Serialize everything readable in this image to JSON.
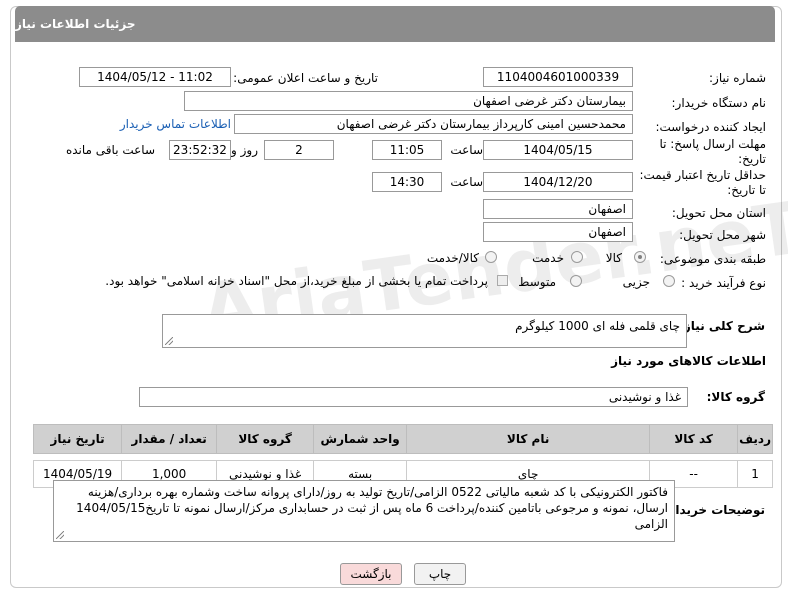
{
  "header": {
    "title": "جزئیات اطلاعات نیاز"
  },
  "watermark": "AriaTender.neT",
  "fields": {
    "need_number_label": "شماره نیاز:",
    "need_number": "1104004601000339",
    "announce_label": "تاریخ و ساعت اعلان عمومی:",
    "announce_value": "1404/05/12 - 11:02",
    "buyer_org_label": "نام دستگاه خریدار:",
    "buyer_org": "بیمارستان دکتر غرضی اصفهان",
    "creator_label": "ایجاد کننده درخواست:",
    "creator": "محمدحسین امینی کارپرداز بیمارستان دکتر غرضی اصفهان",
    "contact_link": "اطلاعات تماس خریدار",
    "deadline_label": "مهلت ارسال پاسخ: تا تاریخ:",
    "deadline_date": "1404/05/15",
    "time_label": "ساعت",
    "deadline_time": "11:05",
    "days": "2",
    "days_label": "روز و",
    "remaining": "23:52:32",
    "remaining_label": "ساعت باقی مانده",
    "min_price_label": "حداقل تاریخ اعتبار قیمت: تا تاریخ:",
    "price_date": "1404/12/20",
    "price_time": "14:30",
    "province_label": "استان محل تحویل:",
    "province": "اصفهان",
    "city_label": "شهر محل تحویل:",
    "city": "اصفهان",
    "category_label": "طبقه بندی موضوعی:",
    "category_options": [
      "کالا",
      "خدمت",
      "کالا/خدمت"
    ],
    "process_label": "نوع فرآیند خرید :",
    "process_options": [
      "جزیی",
      "متوسط"
    ],
    "payment_note": "پرداخت تمام یا بخشی از مبلغ خرید،از محل \"اسناد خزانه اسلامی\" خواهد بود."
  },
  "summary": {
    "label": "شرح کلی نیاز:",
    "text": "چای قلمی فله ای 1000 کیلوگرم"
  },
  "goods": {
    "section_title": "اطلاعات کالاهای مورد نیاز",
    "group_label": "گروه کالا:",
    "group_value": "غذا و نوشیدنی"
  },
  "table": {
    "headers": [
      "ردیف",
      "کد کالا",
      "نام کالا",
      "واحد شمارش",
      "گروه کالا",
      "تعداد / مقدار",
      "تاریخ نیاز"
    ],
    "rows": [
      [
        "1",
        "--",
        "چای",
        "بسته",
        "غذا و نوشیدنی",
        "1,000",
        "1404/05/19"
      ]
    ]
  },
  "buyer_notes": {
    "label": "توضیحات خریدار:",
    "text": "فاکتور الکترونیکی با کد شعبه مالیاتی 0522 الزامی/تاریخ تولید به روز/دارای پروانه ساخت وشماره بهره برداری/هزینه ارسال، نمونه و مرجوعی باتامین کننده/پرداخت 6 ماه پس از ثبت در حسابداری مرکز/ارسال نمونه تا تاریخ1404/05/15 الزامی"
  },
  "buttons": {
    "print": "چاپ",
    "back": "بازگشت"
  },
  "colors": {
    "header_bg": "#8c8c8c",
    "back_btn_bg": "#f9dada",
    "link": "#1a5fb4"
  }
}
